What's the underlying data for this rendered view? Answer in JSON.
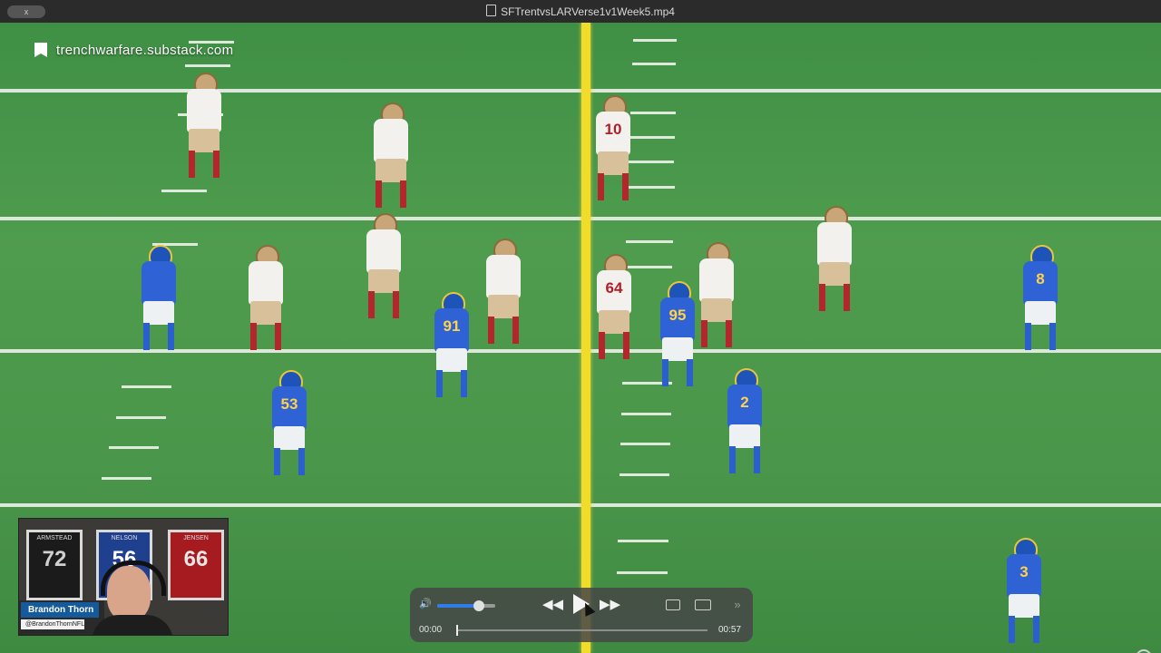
{
  "window": {
    "file_name": "SFTrentvsLARVerse1v1Week5.mp4",
    "close_label": "x"
  },
  "watermark": {
    "text": "trenchwarfare.substack.com",
    "icon": "bookmark-icon"
  },
  "players": [
    {
      "team": "sf",
      "number": ""
    },
    {
      "team": "sf",
      "number": ""
    },
    {
      "team": "sf",
      "number": "10"
    },
    {
      "team": "sf",
      "number": ""
    },
    {
      "team": "sf",
      "number": ""
    },
    {
      "team": "sf",
      "number": ""
    },
    {
      "team": "sf",
      "number": ""
    },
    {
      "team": "sf",
      "number": "64"
    },
    {
      "team": "sf",
      "number": ""
    },
    {
      "team": "sf",
      "number": ""
    },
    {
      "team": "lar",
      "number": ""
    },
    {
      "team": "lar",
      "number": "91"
    },
    {
      "team": "lar",
      "number": "95"
    },
    {
      "team": "lar",
      "number": "8"
    },
    {
      "team": "lar",
      "number": "53"
    },
    {
      "team": "lar",
      "number": "2"
    },
    {
      "team": "lar",
      "number": "3"
    }
  ],
  "webcam": {
    "presenter_name": "Brandon Thorn",
    "presenter_handle": "@BrandonThornNFL",
    "frames": [
      {
        "name": "ARMSTEAD",
        "number": "72",
        "bg": "#1b1b1b",
        "color": "#d0d0d0"
      },
      {
        "name": "NELSON",
        "number": "56",
        "bg": "#1f3f8f",
        "color": "#ffffff"
      },
      {
        "name": "JENSEN",
        "number": "66",
        "bg": "#a61b1f",
        "color": "#e6e6e6"
      }
    ]
  },
  "player_controls": {
    "current_time": "00:00",
    "duration": "00:57",
    "volume_level": 0.72,
    "progress": 0.0,
    "accent_color": "#2f7de8",
    "icons": [
      "volume-icon",
      "rewind-icon",
      "play-icon",
      "fast-forward-icon",
      "airplay-icon",
      "picture-in-picture-icon",
      "more-icon"
    ]
  }
}
